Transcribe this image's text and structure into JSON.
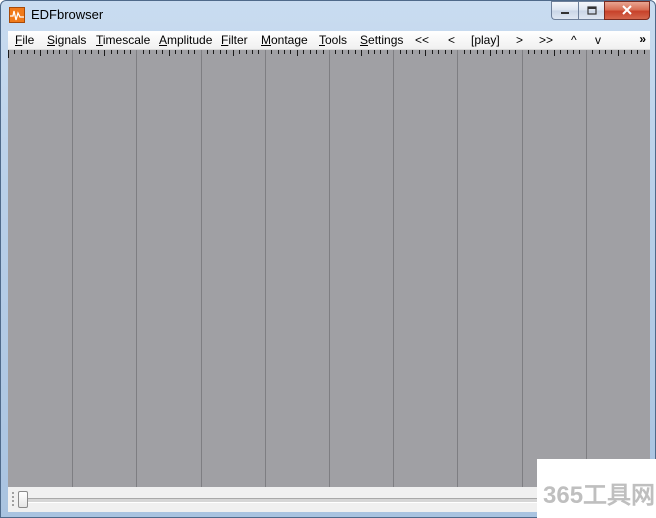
{
  "window": {
    "title": "EDFbrowser",
    "icon": "edfbrowser-app-icon"
  },
  "titlebar_buttons": {
    "minimize_icon": "minimize-icon",
    "maximize_icon": "maximize-icon",
    "close_icon": "close-icon"
  },
  "menu": {
    "items": [
      {
        "label": "File",
        "mnemonic": "F",
        "rest": "ile"
      },
      {
        "label": "Signals",
        "mnemonic": "S",
        "rest": "ignals"
      },
      {
        "label": "Timescale",
        "mnemonic": "T",
        "rest": "imescale"
      },
      {
        "label": "Amplitude",
        "mnemonic": "A",
        "rest": "mplitude"
      },
      {
        "label": "Filter",
        "mnemonic": "F",
        "rest": "ilter"
      },
      {
        "label": "Montage",
        "mnemonic": "M",
        "rest": "ontage"
      },
      {
        "label": "Tools",
        "mnemonic": "T",
        "rest": "ools"
      },
      {
        "label": "Settings",
        "mnemonic": "S",
        "rest": "ettings"
      }
    ],
    "nav": [
      "<<",
      "<",
      "[play]",
      ">",
      ">>",
      "^",
      "v"
    ],
    "overflow": "»"
  },
  "signal_area": {
    "background": "#a0a0a4",
    "grid_color": "#7e7e82",
    "vertical_divisions": 10
  },
  "status": {
    "slider_position": 0
  },
  "watermark": {
    "text": "365工具网"
  }
}
